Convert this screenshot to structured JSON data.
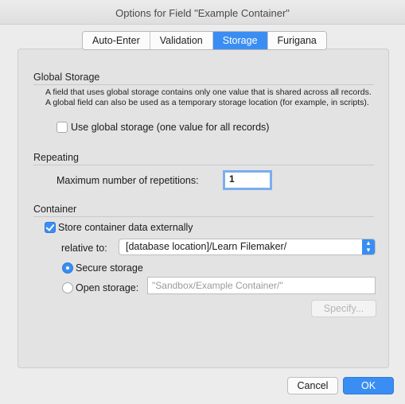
{
  "window": {
    "title": "Options for Field \"Example Container\""
  },
  "tabs": [
    {
      "label": "Auto-Enter"
    },
    {
      "label": "Validation"
    },
    {
      "label": "Storage"
    },
    {
      "label": "Furigana"
    }
  ],
  "active_tab": "Storage",
  "global_storage": {
    "heading": "Global Storage",
    "description": "A field that uses global storage contains only one value that is shared across all records.  A global field can also be used as a temporary storage location (for example, in scripts).",
    "checkbox_label": "Use global storage (one value for all records)",
    "checked": false
  },
  "repeating": {
    "heading": "Repeating",
    "max_label": "Maximum number of repetitions:",
    "max_value": "1"
  },
  "container": {
    "heading": "Container",
    "store_external_label": "Store container data externally",
    "store_external_checked": true,
    "relative_to_label": "relative to:",
    "relative_to_value": "[database location]/Learn Filemaker/",
    "secure_label": "Secure storage",
    "secure_selected": true,
    "open_label": "Open storage:",
    "open_path_placeholder": "\"Sandbox/Example Container/\"",
    "specify_label": "Specify..."
  },
  "footer": {
    "cancel_label": "Cancel",
    "ok_label": "OK"
  },
  "colors": {
    "accent": "#3a8ef3",
    "background": "#ececec"
  }
}
